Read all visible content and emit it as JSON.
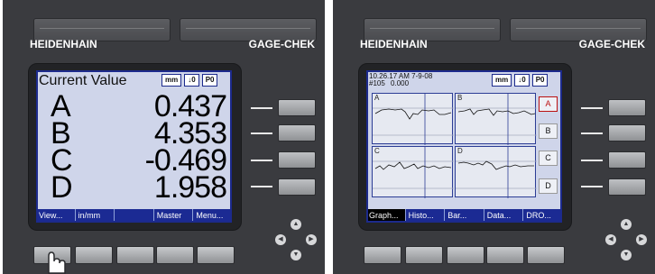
{
  "left_device": {
    "brand": "HEIDENHAIN",
    "model": "GAGE-CHEK",
    "screen_title": "Current Value",
    "toolbar": {
      "unit": "mm",
      "sym": "↓0",
      "p": "P0"
    },
    "readings": [
      {
        "axis": "A",
        "value": "0.437"
      },
      {
        "axis": "B",
        "value": "4.353"
      },
      {
        "axis": "C",
        "value": "-0.469"
      },
      {
        "axis": "D",
        "value": "1.958"
      }
    ],
    "softkeys": [
      "View...",
      "in/mm",
      "",
      "Master",
      "Menu..."
    ]
  },
  "right_device": {
    "brand": "HEIDENHAIN",
    "model": "GAGE-CHEK",
    "header_time": "10.26.17  AM  7-9-08",
    "header_id": "#105",
    "header_value": "0.000",
    "toolbar": {
      "unit": "mm",
      "sym": "↓0",
      "p": "P0"
    },
    "plots": [
      "A",
      "B",
      "C",
      "D"
    ],
    "channel_buttons": [
      "A",
      "B",
      "C",
      "D"
    ],
    "selected_channel": "A",
    "softkeys": [
      "Graph...",
      "Histo...",
      "Bar...",
      "Data...",
      "DRO..."
    ],
    "selected_softkey": "Graph..."
  },
  "colors": {
    "screen_bg": "#cfd5ea",
    "softkey_bg": "#1b2a93",
    "device_bg": "#3a3b3f"
  }
}
